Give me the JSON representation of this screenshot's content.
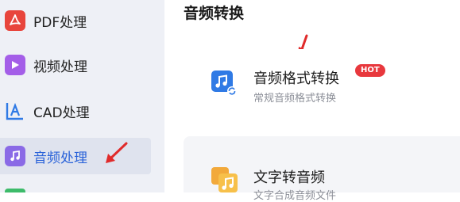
{
  "sidebar": {
    "items": [
      {
        "label": "PDF处理",
        "icon": "pdf-icon",
        "color": "#e8453c"
      },
      {
        "label": "视频处理",
        "icon": "video-icon",
        "color": "#a45ee8"
      },
      {
        "label": "CAD处理",
        "icon": "cad-icon",
        "color": "#2f7ae5"
      },
      {
        "label": "音频处理",
        "icon": "audio-icon",
        "color": "#8a6ae6",
        "active": true
      }
    ]
  },
  "main": {
    "title": "音频转换",
    "cards": [
      {
        "title": "音频格式转换",
        "subtitle": "常规音频格式转换",
        "badge": "HOT",
        "icon": "audio-format-icon"
      },
      {
        "title": "文字转音频",
        "subtitle": "文字合成音频文件",
        "icon": "text-to-audio-icon"
      }
    ]
  },
  "colors": {
    "accent": "#2b63d9",
    "badge": "#e8383d",
    "arrow": "#e02b2b"
  }
}
